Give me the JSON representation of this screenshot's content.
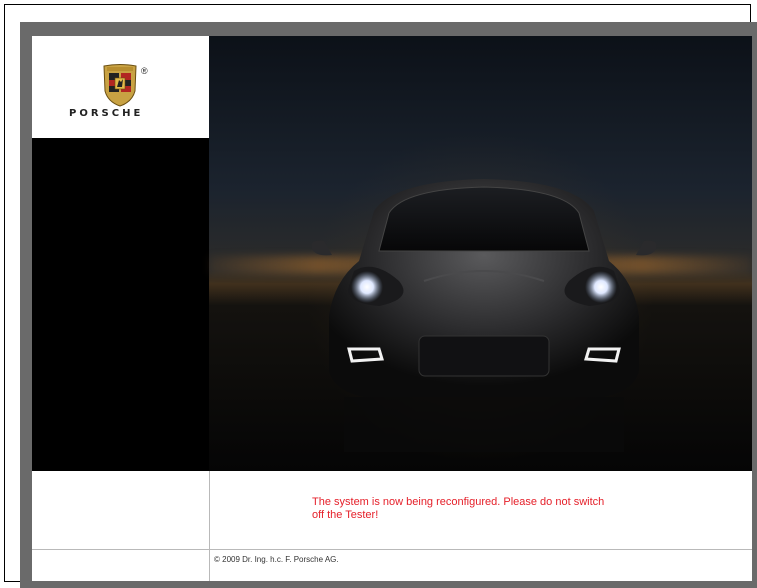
{
  "brand": {
    "wordmark": "PORSCHE",
    "registered": "®",
    "crest_icon": "porsche-crest-icon"
  },
  "status": {
    "message": "The system is now being reconfigured. Please do not switch off the Tester!",
    "color": "#e5202a"
  },
  "footer": {
    "copyright": "© 2009 Dr. Ing. h.c. F. Porsche AG."
  },
  "colors": {
    "frame_border": "#6a6a6a",
    "background": "#000000",
    "panel": "#ffffff"
  }
}
